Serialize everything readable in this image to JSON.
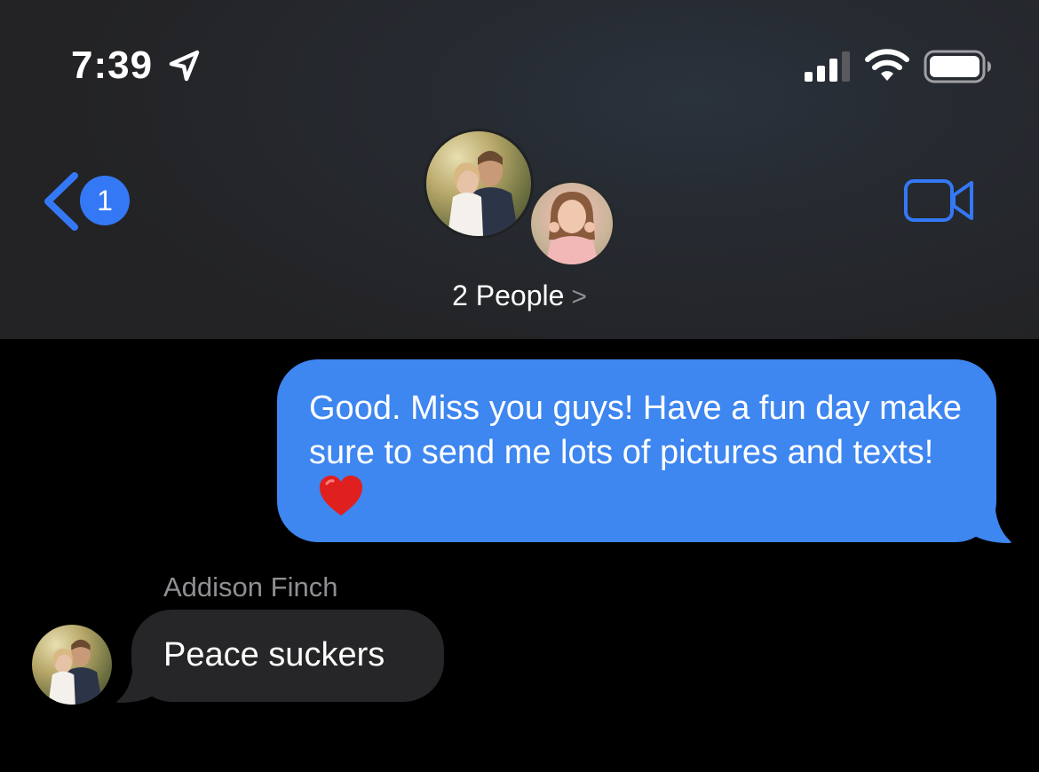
{
  "status_bar": {
    "time": "7:39",
    "icons": [
      "location-arrow-icon",
      "cellular-signal-icon",
      "wifi-icon",
      "battery-icon"
    ]
  },
  "nav": {
    "back_icon": "chevron-left-icon",
    "unread_count": "1",
    "title": "2 People",
    "title_chevron": ">",
    "action_icon": "video-camera-icon"
  },
  "conversation": {
    "avatars": [
      "group-avatar-1",
      "group-avatar-2"
    ],
    "messages": [
      {
        "direction": "outgoing",
        "text": "Good. Miss you guys! Have a fun day make sure to send me lots of pictures and texts!",
        "emoji": "red-heart-icon"
      },
      {
        "direction": "incoming",
        "sender": "Addison Finch",
        "text": "Peace suckers"
      }
    ]
  },
  "colors": {
    "accent": "#3478f6",
    "outgoing_bubble": "#3e86f0",
    "incoming_bubble": "#262628",
    "background": "#000000",
    "header": "#232325",
    "secondary_text": "#8e8e93"
  }
}
